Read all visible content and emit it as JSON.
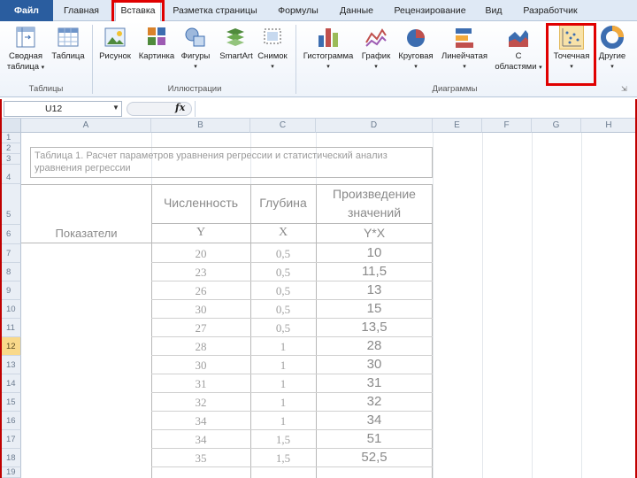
{
  "tabs": [
    "Файл",
    "Главная",
    "Вставка",
    "Разметка страницы",
    "Формулы",
    "Данные",
    "Рецензирование",
    "Вид",
    "Разработчик"
  ],
  "ribbon": {
    "buttons": [
      "Сводная",
      "таблица",
      "Таблица",
      "Рисунок",
      "Картинка",
      "Фигуры",
      "SmartArt",
      "Снимок",
      "Гистограмма",
      "График",
      "Круговая",
      "Линейчатая",
      "С",
      "областями",
      "Точечная",
      "Другие"
    ],
    "groups": [
      "Таблицы",
      "Иллюстрации",
      "Диаграммы"
    ]
  },
  "formula_bar": {
    "name_box": "U12",
    "fx": "fx",
    "formula": ""
  },
  "sheet": {
    "columns": [
      "A",
      "B",
      "C",
      "D",
      "E",
      "F",
      "G",
      "H"
    ],
    "rows": [
      "1",
      "2",
      "3",
      "4",
      "5",
      "6",
      "7",
      "8",
      "9",
      "10",
      "11",
      "12",
      "13",
      "14",
      "15",
      "16",
      "17",
      "18",
      "19"
    ],
    "selected_row": "12",
    "caption": "Таблица 1. Расчет параметров уравнения регрессии и статистический анализ уравнения регрессии",
    "header": {
      "row_label": "Показатели",
      "col_b": "Численность",
      "col_c": "Глубина",
      "col_d_line1": "Произведение",
      "col_d_line2": "значений",
      "sym_b": "Y",
      "sym_c": "X",
      "sym_d": "Y*X"
    },
    "data": [
      [
        "20",
        "0,5",
        "10"
      ],
      [
        "23",
        "0,5",
        "11,5"
      ],
      [
        "26",
        "0,5",
        "13"
      ],
      [
        "30",
        "0,5",
        "15"
      ],
      [
        "27",
        "0,5",
        "13,5"
      ],
      [
        "28",
        "1",
        "28"
      ],
      [
        "30",
        "1",
        "30"
      ],
      [
        "31",
        "1",
        "31"
      ],
      [
        "32",
        "1",
        "32"
      ],
      [
        "34",
        "1",
        "34"
      ],
      [
        "34",
        "1,5",
        "51"
      ],
      [
        "35",
        "1,5",
        "52,5"
      ]
    ]
  }
}
